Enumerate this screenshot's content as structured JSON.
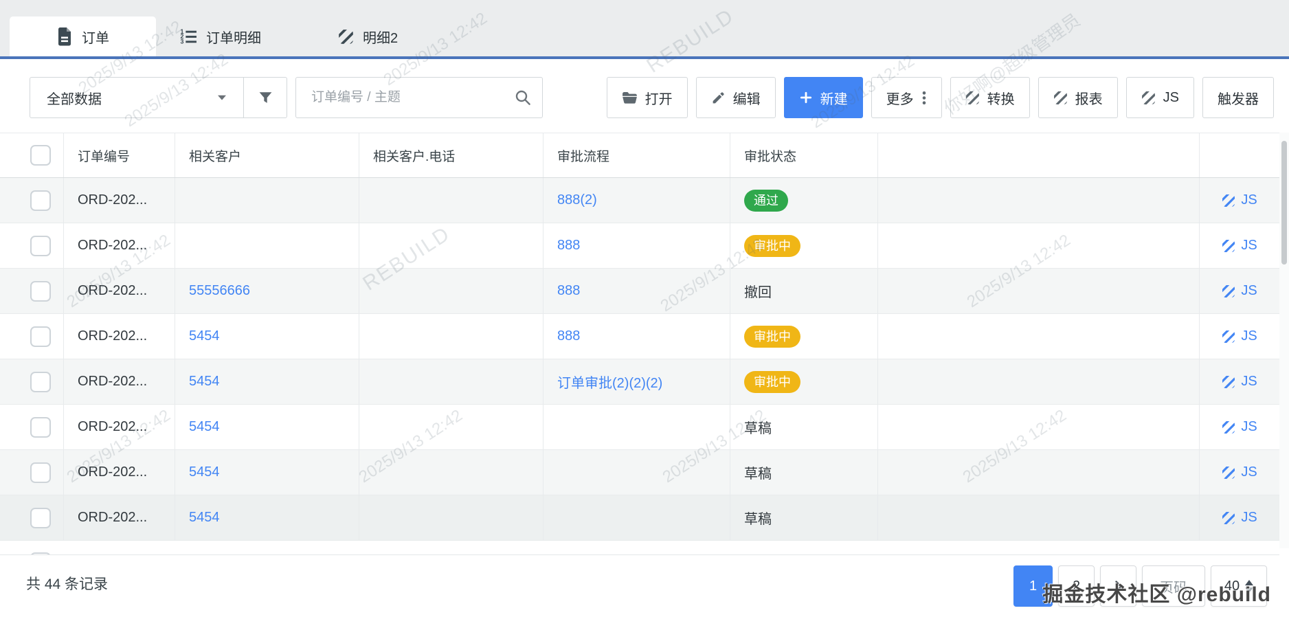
{
  "tabs": [
    {
      "label": "订单",
      "icon": "file-icon",
      "active": true
    },
    {
      "label": "订单明细",
      "icon": "ordered-list-icon",
      "active": false
    },
    {
      "label": "明细2",
      "icon": "striped-entity-icon",
      "active": false
    }
  ],
  "toolbar": {
    "data_filter": "全部数据",
    "search_placeholder": "订单编号 / 主题",
    "open_label": "打开",
    "edit_label": "编辑",
    "create_label": "新建",
    "more_label": "更多",
    "convert_label": "转换",
    "report_label": "报表",
    "js_label": "JS",
    "trigger_label": "触发器"
  },
  "table": {
    "headers": [
      "订单编号",
      "相关客户",
      "相关客户.电话",
      "审批流程",
      "审批状态"
    ],
    "action_label": "JS",
    "rows": [
      {
        "order_no": "ORD-202...",
        "customer": "",
        "phone": "",
        "flow": "888(2)",
        "status": "通过",
        "status_type": "success"
      },
      {
        "order_no": "ORD-202...",
        "customer": "",
        "phone": "",
        "flow": "888",
        "status": "审批中",
        "status_type": "warning"
      },
      {
        "order_no": "ORD-202...",
        "customer": "55556666",
        "phone": "",
        "flow": "888",
        "status": "撤回",
        "status_type": "plain"
      },
      {
        "order_no": "ORD-202...",
        "customer": "5454",
        "phone": "",
        "flow": "888",
        "status": "审批中",
        "status_type": "warning"
      },
      {
        "order_no": "ORD-202...",
        "customer": "5454",
        "phone": "",
        "flow": "订单审批(2)(2)(2)",
        "status": "审批中",
        "status_type": "warning"
      },
      {
        "order_no": "ORD-202...",
        "customer": "5454",
        "phone": "",
        "flow": "",
        "status": "草稿",
        "status_type": "plain"
      },
      {
        "order_no": "ORD-202...",
        "customer": "5454",
        "phone": "",
        "flow": "",
        "status": "草稿",
        "status_type": "plain"
      },
      {
        "order_no": "ORD-202...",
        "customer": "5454",
        "phone": "",
        "flow": "",
        "status": "草稿",
        "status_type": "plain",
        "hover": true
      }
    ]
  },
  "footer": {
    "total": "共 44 条记录",
    "pages": [
      "1",
      "2"
    ],
    "page_jump_label": "页码",
    "page_size": "40"
  },
  "watermarks": {
    "datetime": "2025/9/13 12:42",
    "brand": "REBUILD",
    "user": "你好啊@超级管理员",
    "community": "掘金技术社区 @rebuild"
  },
  "colors": {
    "accent": "#4285f4",
    "tab_underline": "#4a74ba",
    "success": "#2fa84c",
    "warning": "#f0b616",
    "stripe": "#f4f6f6"
  }
}
